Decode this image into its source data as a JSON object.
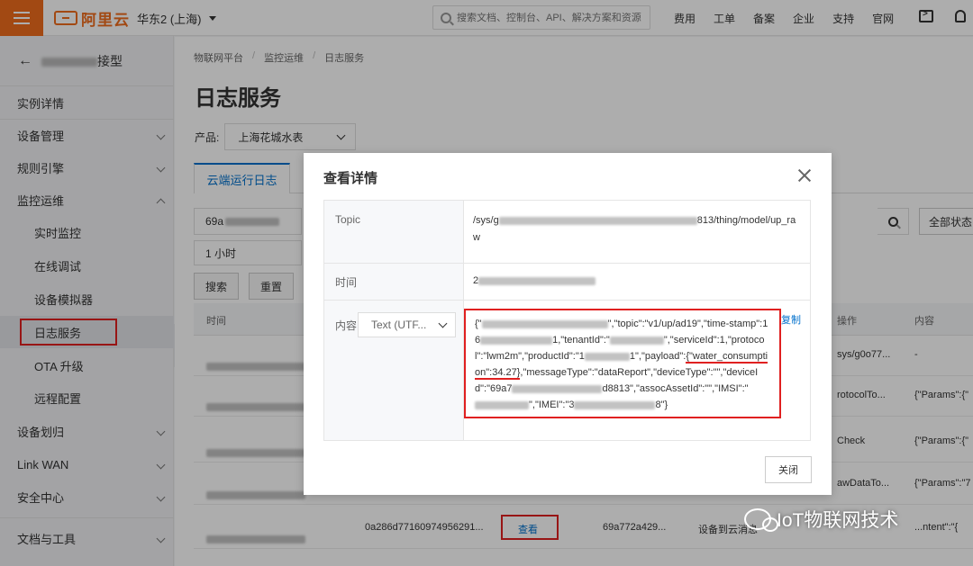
{
  "topbar": {
    "logo_text": "阿里云",
    "region": "华东2 (上海)",
    "search_placeholder": "搜索文档、控制台、API、解决方案和资源",
    "nav": [
      "费用",
      "工单",
      "备案",
      "企业",
      "支持",
      "官网"
    ],
    "brand_color": "#ef6c1d"
  },
  "sidebar": {
    "back_title_suffix": "接型",
    "items": [
      {
        "label": "实例详情"
      },
      {
        "label": "设备管理"
      },
      {
        "label": "规则引擎"
      },
      {
        "label": "监控运维"
      },
      {
        "label": "实时监控"
      },
      {
        "label": "在线调试"
      },
      {
        "label": "设备模拟器"
      },
      {
        "label": "日志服务"
      },
      {
        "label": "OTA 升级"
      },
      {
        "label": "远程配置"
      },
      {
        "label": "设备划归"
      },
      {
        "label": "Link WAN"
      },
      {
        "label": "安全中心"
      },
      {
        "label": "文档与工具"
      }
    ]
  },
  "main": {
    "breadcrumb": [
      "物联网平台",
      "监控运维",
      "日志服务"
    ],
    "title": "日志服务",
    "product_label": "产品:",
    "product_value": "上海花城水表",
    "tab_active": "云端运行日志",
    "filter_device_prefix": "69a",
    "filter_status": "全部状态",
    "time_range": "1 小时",
    "search_button": "搜索",
    "reset_button": "重置",
    "columns": {
      "time": "时间",
      "action": "操作",
      "content": "内容"
    },
    "rows": [
      {
        "op": "sys/g0o77...",
        "content": "-"
      },
      {
        "op": "rotocolTo...",
        "content": "{\"Params\":{\""
      },
      {
        "op": "Check",
        "content": "{\"Params\":{\""
      },
      {
        "op": "awDataTo...",
        "content": "{\"Params\":\"7"
      },
      {
        "msgid": "0a286d77160974956291...",
        "view": "查看",
        "device": "69a772a429...",
        "op": "设备到云消息",
        "content": "...ntent\":\"{"
      }
    ]
  },
  "modal": {
    "title": "查看详情",
    "topic_label": "Topic",
    "topic_prefix": "/sys/g",
    "topic_suffix": "813/thing/model/up_raw",
    "time_label": "时间",
    "time_prefix": "2",
    "content_label": "内容",
    "encoding": "Text (UTF...",
    "copy_label": "复制",
    "payload_p1": "{\"",
    "payload_p2": "\",\"topic\":\"v1/up/ad19\",\"time-stamp\":16",
    "payload_p3": "1,\"tenantId\":\"",
    "payload_p4": "\",\"serviceId\":1,\"protocol\":\"lwm2m\",\"productId\":\"1",
    "payload_p5": "1\",\"payload\":",
    "payload_highlight": "{\"water_consumption\":34.27}",
    "payload_p6": ",\"messageType\":\"dataReport\",\"deviceType\":\"\",\"deviceId\":\"69a7",
    "payload_p7": "d8813\",\"assocAssetId\":\"\",\"IMSI\":\"",
    "payload_p8": "\",\"IMEI\":\"3",
    "payload_p9": "8\"}",
    "close_button": "关闭"
  },
  "watermark": {
    "text": "IoT物联网技术"
  }
}
